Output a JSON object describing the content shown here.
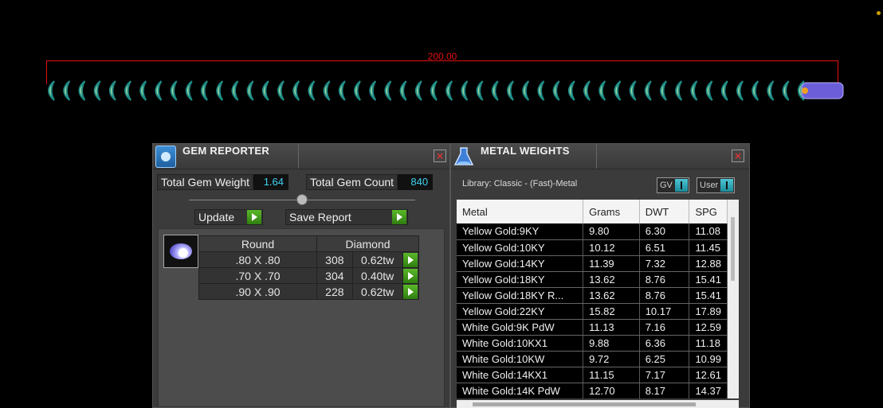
{
  "viewport": {
    "dimension_label": "200.00",
    "colors": {
      "dimension": "#e41010",
      "chain_link": "#a9e0a0",
      "chain_shadow": "#1f8c86",
      "clasp": "#6b5ed8"
    }
  },
  "gem_reporter": {
    "title": "GEM REPORTER",
    "total_weight_label": "Total Gem Weight",
    "total_weight_value": "1.64",
    "total_count_label": "Total Gem Count",
    "total_count_value": "840",
    "update_label": "Update",
    "save_report_label": "Save Report",
    "table_header": {
      "shape": "Round",
      "material": "Diamond"
    },
    "rows": [
      {
        "size": ".80 X .80",
        "count": "308",
        "weight": "0.62tw"
      },
      {
        "size": ".70 X .70",
        "count": "304",
        "weight": "0.40tw"
      },
      {
        "size": ".90 X .90",
        "count": "228",
        "weight": "0.62tw"
      }
    ]
  },
  "metal_weights": {
    "title": "METAL WEIGHTS",
    "library_label": "Library: Classic - (Fast)-Metal",
    "toggle_gv": "GV",
    "toggle_user": "User",
    "columns": [
      "Metal",
      "Grams",
      "DWT",
      "SPG"
    ],
    "rows": [
      {
        "metal": "Yellow Gold:9KY",
        "grams": "9.80",
        "dwt": "6.30",
        "spg": "11.08"
      },
      {
        "metal": "Yellow Gold:10KY",
        "grams": "10.12",
        "dwt": "6.51",
        "spg": "11.45"
      },
      {
        "metal": "Yellow Gold:14KY",
        "grams": "11.39",
        "dwt": "7.32",
        "spg": "12.88"
      },
      {
        "metal": "Yellow Gold:18KY",
        "grams": "13.62",
        "dwt": "8.76",
        "spg": "15.41"
      },
      {
        "metal": "Yellow Gold:18KY R...",
        "grams": "13.62",
        "dwt": "8.76",
        "spg": "15.41"
      },
      {
        "metal": "Yellow Gold:22KY",
        "grams": "15.82",
        "dwt": "10.17",
        "spg": "17.89"
      },
      {
        "metal": "White Gold:9K PdW",
        "grams": "11.13",
        "dwt": "7.16",
        "spg": "12.59"
      },
      {
        "metal": "White Gold:10KX1",
        "grams": "9.88",
        "dwt": "6.36",
        "spg": "11.18"
      },
      {
        "metal": "White Gold:10KW",
        "grams": "9.72",
        "dwt": "6.25",
        "spg": "10.99"
      },
      {
        "metal": "White Gold:14KX1",
        "grams": "11.15",
        "dwt": "7.17",
        "spg": "12.61"
      },
      {
        "metal": "White Gold:14K PdW",
        "grams": "12.70",
        "dwt": "8.17",
        "spg": "14.37"
      }
    ]
  }
}
